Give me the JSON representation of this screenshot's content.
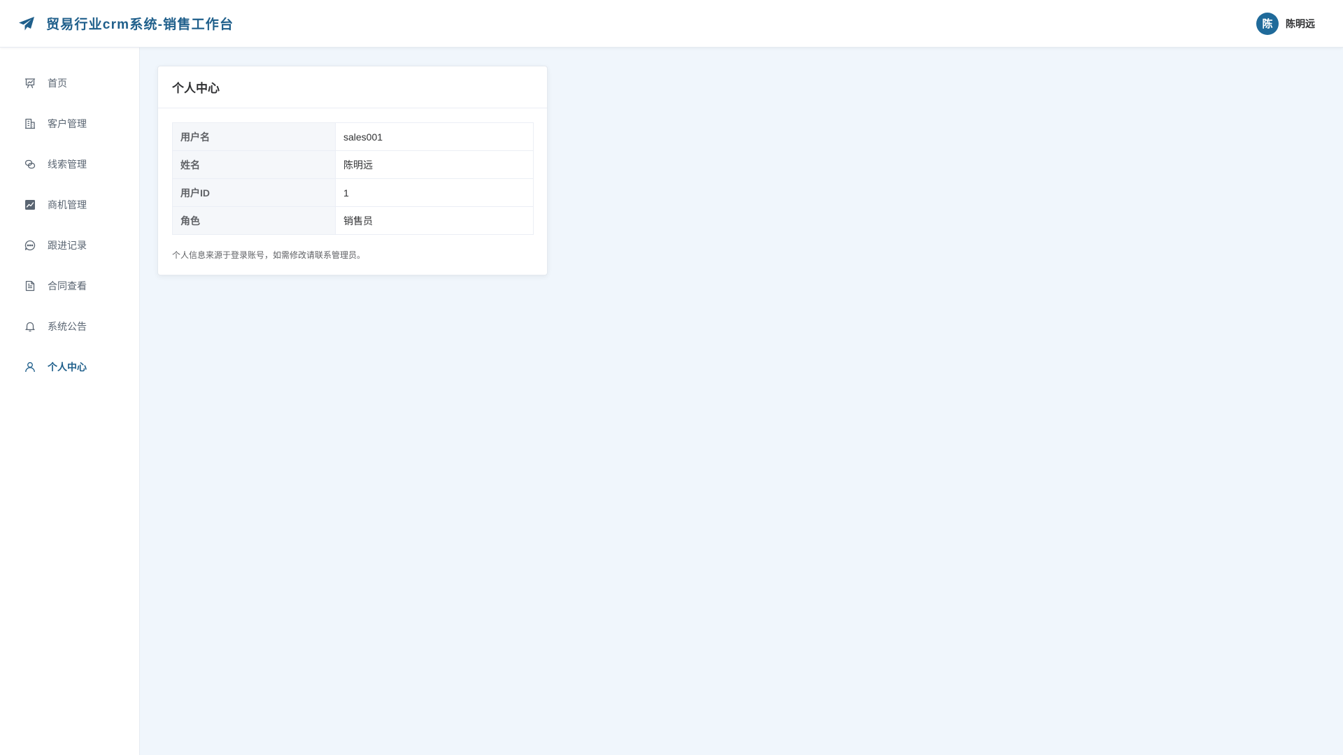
{
  "header": {
    "title": "贸易行业crm系统-销售工作台",
    "brand_icon": "paper-plane-icon",
    "user": {
      "avatar_text": "陈",
      "name": "陈明远"
    }
  },
  "sidebar": {
    "items": [
      {
        "label": "首页",
        "icon": "presentation-icon",
        "active": false
      },
      {
        "label": "客户管理",
        "icon": "building-icon",
        "active": false
      },
      {
        "label": "线索管理",
        "icon": "link-icon",
        "active": false
      },
      {
        "label": "商机管理",
        "icon": "chart-icon",
        "active": false
      },
      {
        "label": "跟进记录",
        "icon": "chat-icon",
        "active": false
      },
      {
        "label": "合同查看",
        "icon": "document-icon",
        "active": false
      },
      {
        "label": "系统公告",
        "icon": "bell-icon",
        "active": false
      },
      {
        "label": "个人中心",
        "icon": "user-icon",
        "active": true
      }
    ]
  },
  "card": {
    "title": "个人中心",
    "rows": [
      {
        "label": "用户名",
        "value": "sales001"
      },
      {
        "label": "姓名",
        "value": "陈明远"
      },
      {
        "label": "用户ID",
        "value": "1"
      },
      {
        "label": "角色",
        "value": "销售员"
      }
    ],
    "note": "个人信息来源于登录账号，如需修改请联系管理员。"
  },
  "colors": {
    "accent": "#1f5f8b",
    "avatar_bg": "#1f6a9a",
    "page_bg": "#f0f6fc",
    "nav_text": "#5a6572"
  }
}
